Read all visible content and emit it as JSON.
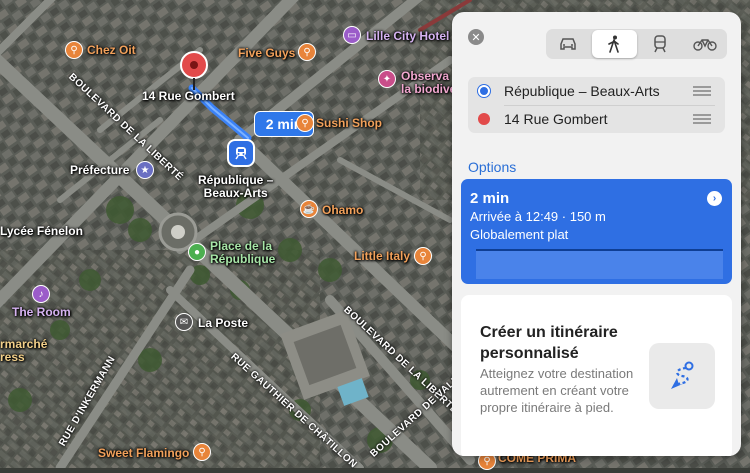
{
  "map": {
    "pois": [
      {
        "id": "chez-oit",
        "label": "Chez Oit",
        "color": "#e8843a",
        "icon": "fork-knife-icon"
      },
      {
        "id": "five-guys",
        "label": "Five Guys",
        "color": "#e8843a",
        "icon": "fork-knife-icon"
      },
      {
        "id": "lille-city-hotel",
        "label": "Lille City Hotel",
        "color": "#9b5cc9",
        "icon": "bed-icon"
      },
      {
        "id": "observatoire",
        "label": "Observa\nla biodive",
        "color": "#c94e8a",
        "icon": "star-icon"
      },
      {
        "id": "sushi-shop",
        "label": "Sushi Shop",
        "color": "#e8843a",
        "icon": "fork-knife-icon"
      },
      {
        "id": "prefecture",
        "label": "Préfecture",
        "color": "#6a6fc2",
        "icon": "star-icon"
      },
      {
        "id": "ohamo",
        "label": "Ohamo",
        "color": "#e8843a",
        "icon": "cup-icon"
      },
      {
        "id": "lycee",
        "label": "Lycée Fénelon",
        "color": "#8a8a8a",
        "icon": "school-icon"
      },
      {
        "id": "place-republique",
        "label": "Place de la\nRépublique",
        "color": "#4caf50",
        "icon": "tree-icon"
      },
      {
        "id": "little-italy",
        "label": "Little Italy",
        "color": "#e8843a",
        "icon": "fork-knife-icon"
      },
      {
        "id": "the-room",
        "label": "The Room",
        "color": "#9b5cc9",
        "icon": "music-icon"
      },
      {
        "id": "la-poste",
        "label": "La Poste",
        "color": "#555",
        "icon": "mail-icon"
      },
      {
        "id": "supermarche",
        "label": "rmarché\nress",
        "color": "#e8b33a",
        "icon": "cart-icon"
      },
      {
        "id": "sweet-flamingo",
        "label": "Sweet Flamingo",
        "color": "#e8843a",
        "icon": "fork-knife-icon"
      },
      {
        "id": "come-prima",
        "label": "COME PRIMA",
        "color": "#e8843a",
        "icon": "fork-knife-icon"
      }
    ],
    "streets": [
      {
        "id": "bd-liberte",
        "label": "BOULEVARD DE LA LIBERTÉ"
      },
      {
        "id": "bd-liberte-2",
        "label": "BOULEVARD DE LA LIBERTÉ"
      },
      {
        "id": "rue-inkermann",
        "label": "RUE D'INKERMANN"
      },
      {
        "id": "rue-gauthier",
        "label": "RUE GAUTHIER DE CHÂTILLON"
      },
      {
        "id": "bd-valmy",
        "label": "BOULEVARD DE VALMY"
      }
    ],
    "destination_label": "14 Rue Gombert",
    "station_label": "République –\nBeaux-Arts",
    "route_time_bubble": "2 min",
    "route_color": "#3b82f6"
  },
  "panel": {
    "close_label": "✕",
    "modes": [
      {
        "id": "car",
        "icon": "car-icon",
        "active": false
      },
      {
        "id": "walk",
        "icon": "walk-icon",
        "active": true
      },
      {
        "id": "transit",
        "icon": "train-icon",
        "active": false
      },
      {
        "id": "bike",
        "icon": "bike-icon",
        "active": false
      }
    ],
    "from": "République – Beaux-Arts",
    "to": "14 Rue Gombert",
    "options_label": "Options",
    "route": {
      "duration": "2 min",
      "arrival": "Arrivée à 12:49 · 150 m",
      "terrain": "Globalement plat"
    },
    "custom": {
      "title": "Créer un itinéraire personnalisé",
      "description": "Atteignez votre destination autrement en créant votre propre itinéraire à pied."
    }
  }
}
